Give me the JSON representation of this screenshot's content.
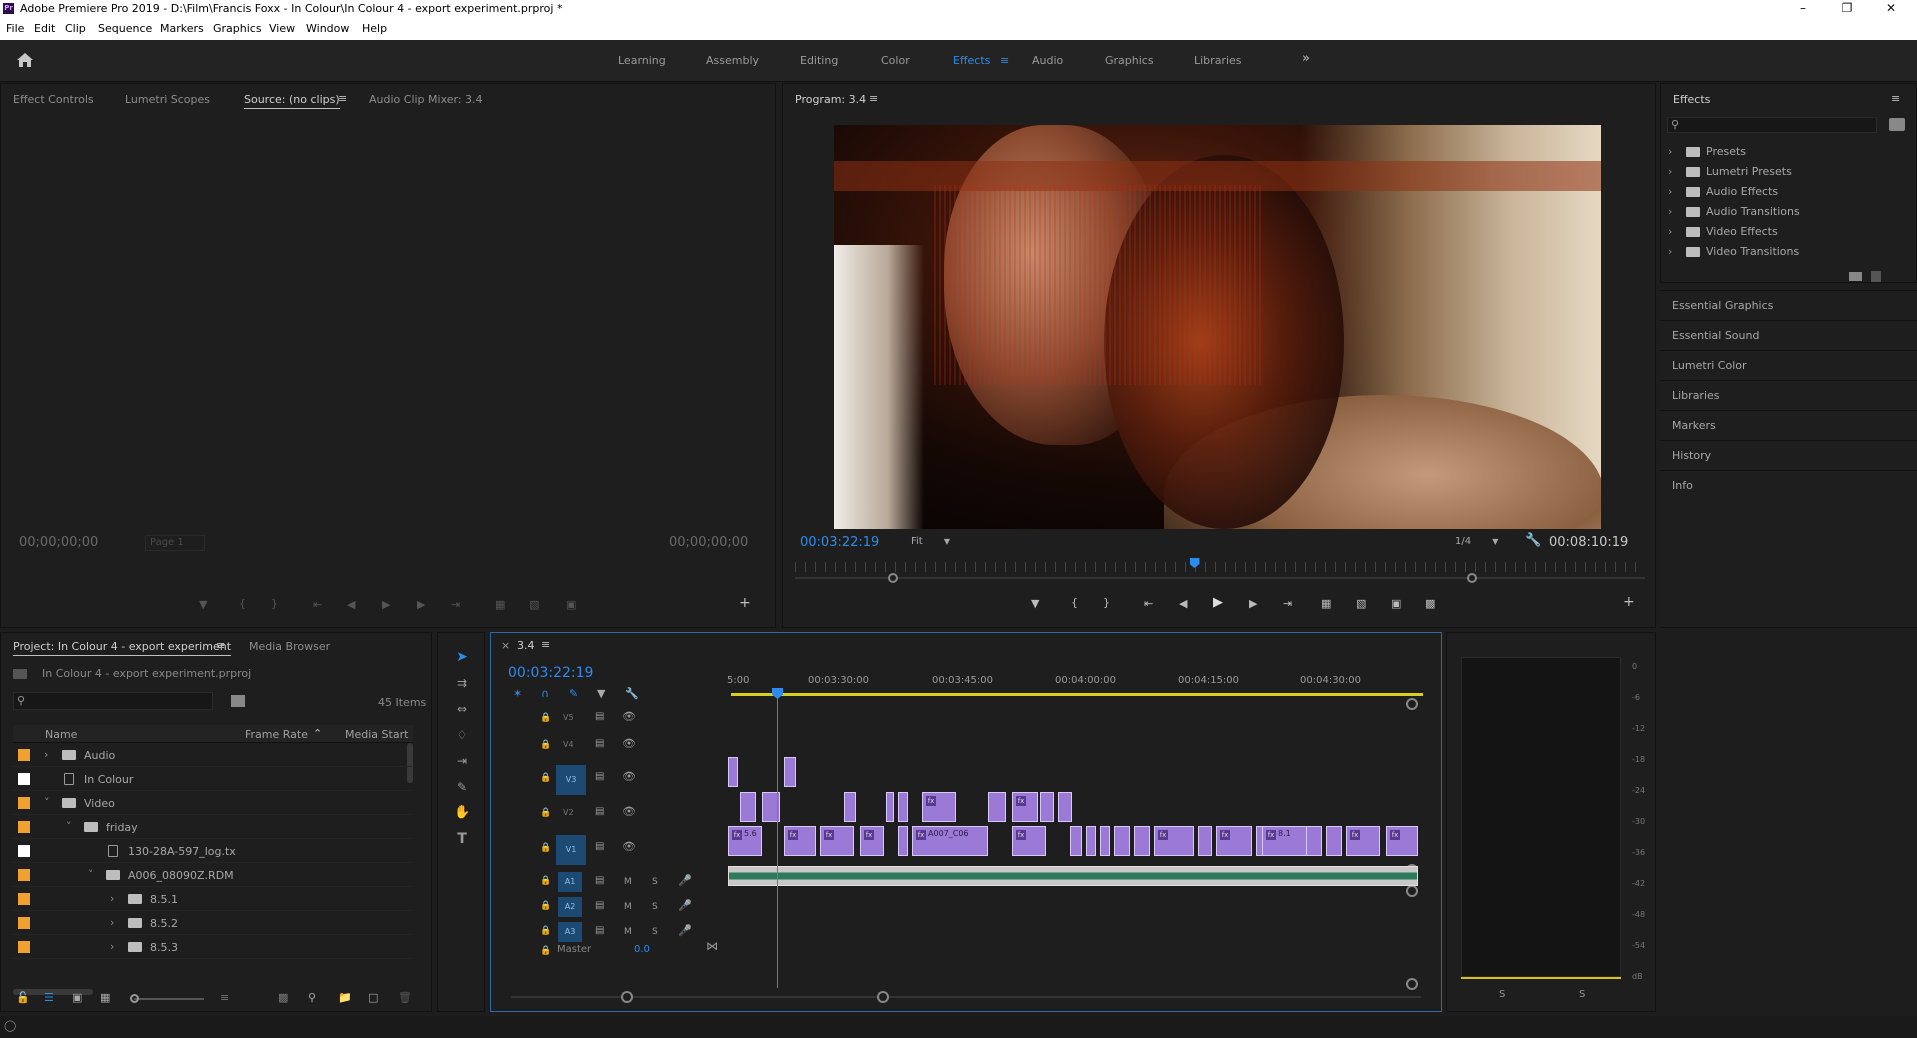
{
  "window": {
    "title": "Adobe Premiere Pro 2019 - D:\\Film\\Francis Foxx - In Colour\\In Colour 4 - export experiment.prproj *",
    "minimize": "–",
    "restore": "❐",
    "close": "✕"
  },
  "menu": [
    "File",
    "Edit",
    "Clip",
    "Sequence",
    "Markers",
    "Graphics",
    "View",
    "Window",
    "Help"
  ],
  "workspaces": [
    "Learning",
    "Assembly",
    "Editing",
    "Color",
    "Effects",
    "Audio",
    "Graphics",
    "Libraries"
  ],
  "workspace_active": "Effects",
  "workspace_more": "»",
  "source_panel": {
    "tabs": [
      "Effect Controls",
      "Lumetri Scopes",
      "Source: (no clips)",
      "Audio Clip Mixer: 3.4"
    ],
    "active_tab": "Source: (no clips)",
    "timecode_left": "00;00;00;00",
    "page": "Page 1",
    "timecode_right": "00;00;00;00"
  },
  "program_panel": {
    "title": "Program: 3.4",
    "timecode": "00:03:22:19",
    "fit": "Fit",
    "resolution": "1/4",
    "duration": "00:08:10:19",
    "playhead_fraction": 0.47
  },
  "effects_panel": {
    "title": "Effects",
    "search_placeholder": "",
    "items": [
      "Presets",
      "Lumetri Presets",
      "Audio Effects",
      "Audio Transitions",
      "Video Effects",
      "Video Transitions"
    ]
  },
  "side_panels": [
    "Essential Graphics",
    "Essential Sound",
    "Lumetri Color",
    "Libraries",
    "Markers",
    "History",
    "Info"
  ],
  "project_panel": {
    "tabs": [
      "Project: In Colour 4 - export experiment",
      "Media Browser"
    ],
    "file": "In Colour 4 - export experiment.prproj",
    "count": "45 Items",
    "columns": [
      "Name",
      "Frame Rate",
      "Media Start"
    ],
    "rows": [
      {
        "name": "Audio",
        "color": "#f0a030",
        "indent": 0,
        "type": "folder",
        "expand": "›"
      },
      {
        "name": "In Colour",
        "color": "#ffffff",
        "indent": 0,
        "type": "sequence",
        "expand": ""
      },
      {
        "name": "Video",
        "color": "#f0a030",
        "indent": 0,
        "type": "folder",
        "expand": "˅"
      },
      {
        "name": "friday",
        "color": "#f0a030",
        "indent": 1,
        "type": "folder",
        "expand": "˅"
      },
      {
        "name": "130-28A-597_log.tx",
        "color": "#ffffff",
        "indent": 2,
        "type": "file",
        "expand": ""
      },
      {
        "name": "A006_08090Z.RDM",
        "color": "#f0a030",
        "indent": 2,
        "type": "folder",
        "expand": "˅"
      },
      {
        "name": "8.5.1",
        "color": "#f0a030",
        "indent": 3,
        "type": "folder",
        "expand": "›"
      },
      {
        "name": "8.5.2",
        "color": "#f0a030",
        "indent": 3,
        "type": "folder",
        "expand": "›"
      },
      {
        "name": "8.5.3",
        "color": "#f0a030",
        "indent": 3,
        "type": "folder",
        "expand": "›"
      }
    ]
  },
  "timeline": {
    "tab": "3.4",
    "close": "×",
    "timecode": "00:03:22:19",
    "ruler": [
      "5:00",
      "00:03:30:00",
      "00:03:45:00",
      "00:04:00:00",
      "00:04:15:00",
      "00:04:30:00"
    ],
    "video_tracks": [
      "V5",
      "V4",
      "V3",
      "V2",
      "V1"
    ],
    "audio_tracks": [
      "A1",
      "A2",
      "A3"
    ],
    "master": "Master",
    "master_value": "0.0",
    "mute": "M",
    "solo": "S",
    "clip_labels": {
      "v1_first": "5.6",
      "v1_mid": "A007_C06",
      "v1_later": "8.1"
    }
  },
  "meters": {
    "scale": [
      "0",
      "-6",
      "-12",
      "-18",
      "-24",
      "-30",
      "-36",
      "-42",
      "-48",
      "-54",
      "dB"
    ],
    "solo": [
      "S",
      "S"
    ]
  },
  "icons": {
    "home": "home-icon",
    "search": "search-icon",
    "menu": "≡"
  }
}
